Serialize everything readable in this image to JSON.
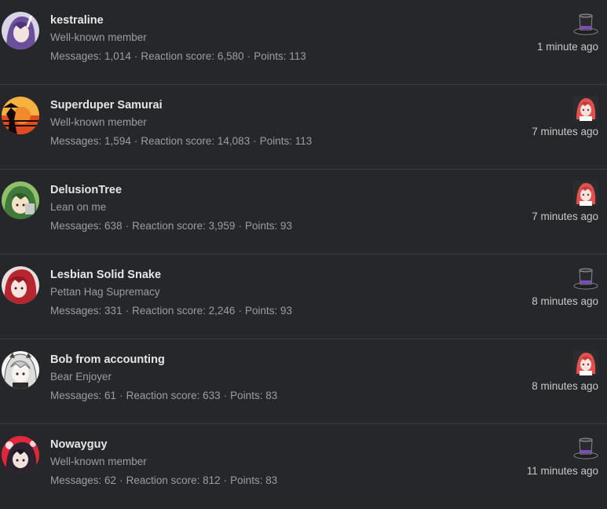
{
  "members": [
    {
      "username": "kestraline",
      "title": "Well-known member",
      "messages_label": "Messages:",
      "messages": "1,014",
      "reaction_label": "Reaction score:",
      "reaction": "6,580",
      "points_label": "Points:",
      "points": "113",
      "time": "1 minute ago",
      "avatar": "purple-haired-anime-avatar",
      "activity_icon": "top-hat-icon"
    },
    {
      "username": "Superduper Samurai",
      "title": "Well-known member",
      "messages_label": "Messages:",
      "messages": "1,594",
      "reaction_label": "Reaction score:",
      "reaction": "14,083",
      "points_label": "Points:",
      "points": "113",
      "time": "7 minutes ago",
      "avatar": "samurai-sunset-avatar",
      "activity_icon": "anime-girl-icon"
    },
    {
      "username": "DelusionTree",
      "title": "Lean on me",
      "messages_label": "Messages:",
      "messages": "638",
      "reaction_label": "Reaction score:",
      "reaction": "3,959",
      "points_label": "Points:",
      "points": "93",
      "time": "7 minutes ago",
      "avatar": "green-haired-anime-avatar",
      "activity_icon": "anime-girl-icon"
    },
    {
      "username": "Lesbian Solid Snake",
      "title": "Pettan Hag Supremacy",
      "messages_label": "Messages:",
      "messages": "331",
      "reaction_label": "Reaction score:",
      "reaction": "2,246",
      "points_label": "Points:",
      "points": "93",
      "time": "8 minutes ago",
      "avatar": "red-haired-anime-avatar",
      "activity_icon": "top-hat-icon"
    },
    {
      "username": "Bob from accounting",
      "title": "Bear Enjoyer",
      "messages_label": "Messages:",
      "messages": "61",
      "reaction_label": "Reaction score:",
      "reaction": "633",
      "points_label": "Points:",
      "points": "83",
      "time": "8 minutes ago",
      "avatar": "white-haired-anime-avatar",
      "activity_icon": "anime-girl-icon"
    },
    {
      "username": "Nowayguy",
      "title": "Well-known member",
      "messages_label": "Messages:",
      "messages": "62",
      "reaction_label": "Reaction score:",
      "reaction": "812",
      "points_label": "Points:",
      "points": "83",
      "time": "11 minutes ago",
      "avatar": "dark-haired-red-background-avatar",
      "activity_icon": "top-hat-icon"
    }
  ],
  "colors": {
    "background": "#25272b",
    "divider": "#3a3d42",
    "username": "#e6e6e6",
    "muted": "#9a9ea3",
    "time": "#c8c8c8"
  }
}
